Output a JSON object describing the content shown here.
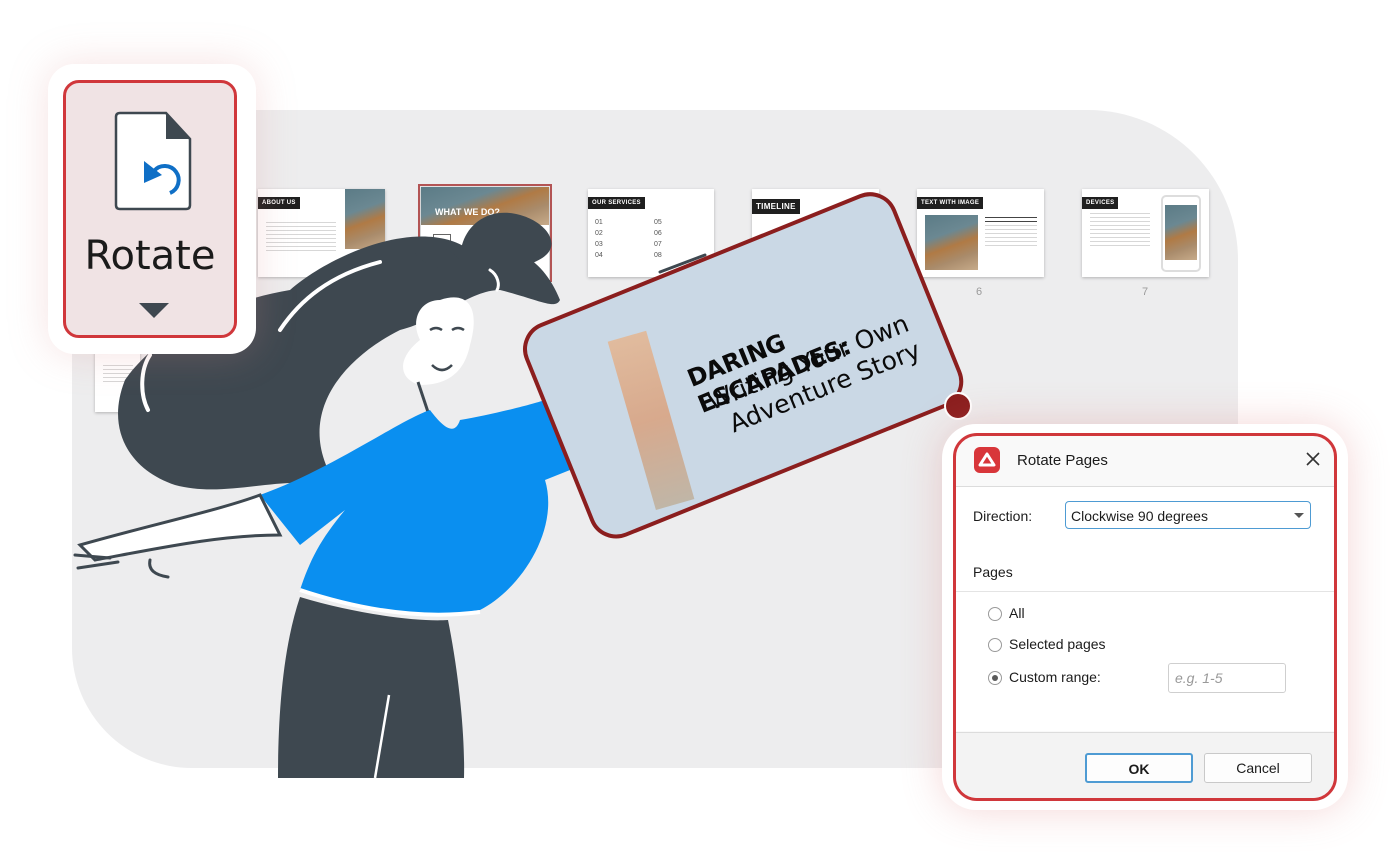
{
  "ribbon": {
    "rotate_label": "Rotate",
    "rotate_icon": "document-rotate-icon",
    "dropdown_icon": "caret-down-icon"
  },
  "thumbnails": [
    {
      "tag": "ABOUT US",
      "page": ""
    },
    {
      "tag": "WHAT WE DO?",
      "page": "",
      "selected": true
    },
    {
      "tag": "OUR SERVICES",
      "page": "",
      "numbers": [
        "01",
        "02",
        "03",
        "04",
        "05",
        "06",
        "07",
        "08"
      ]
    },
    {
      "tag": "TIMELINE",
      "page": ""
    },
    {
      "tag": "TEXT WITH IMAGE",
      "page": "6"
    },
    {
      "tag": "DEVICES",
      "page": "7"
    }
  ],
  "floating_slide": {
    "title": "DARING ESCAPADES:",
    "subtitle_line1": "Writing Your Own",
    "subtitle_line2": "Adventure Story"
  },
  "dialog": {
    "title": "Rotate Pages",
    "direction_label": "Direction:",
    "direction_value": "Clockwise 90 degrees",
    "pages_label": "Pages",
    "options": [
      {
        "label": "All",
        "checked": false
      },
      {
        "label": "Selected pages",
        "checked": false
      },
      {
        "label": "Custom range:",
        "checked": true
      }
    ],
    "range_placeholder": "e.g. 1-5",
    "ok_label": "OK",
    "cancel_label": "Cancel"
  },
  "colors": {
    "accent_red": "#d0373b",
    "dark_red": "#8b1e1e",
    "shirt_blue": "#0a8ff0",
    "hair_dark": "#3e4850",
    "focus_blue": "#4e9bd3"
  }
}
